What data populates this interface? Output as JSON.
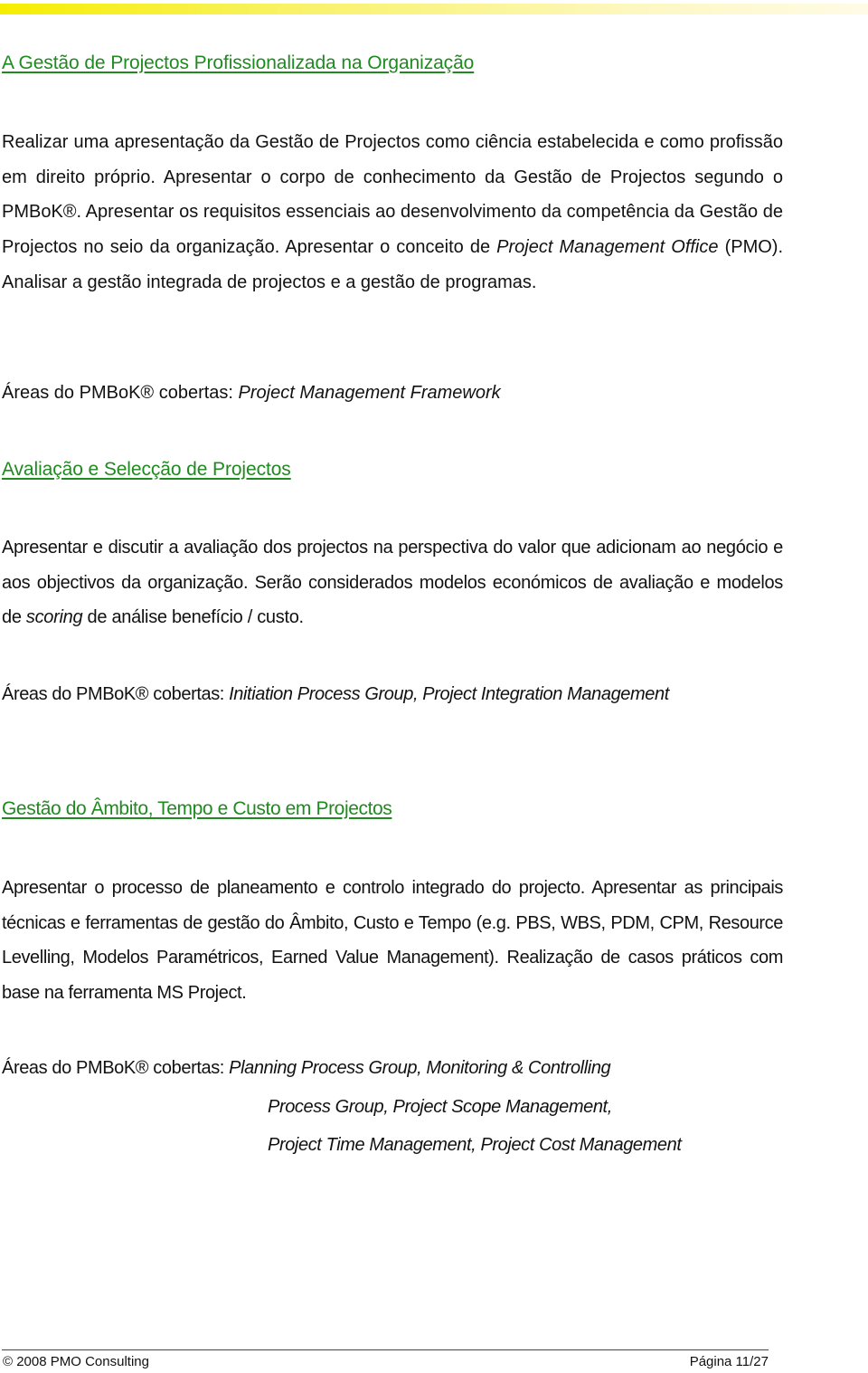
{
  "header": {
    "bar_color": "#f6ee00"
  },
  "sections": [
    {
      "title": "A Gestão de Projectos Profissionalizada na Organização",
      "body_parts": [
        "Realizar uma apresentação da Gestão de Projectos como ciência estabelecida e como profissão em direito próprio. Apresentar o corpo de conhecimento da Gestão de Projectos segundo o PMBoK®. Apresentar os requisitos essenciais ao desenvolvimento da competência da Gestão de Projectos no seio da organização. Apresentar o conceito de ",
        "Project Management Office",
        " (PMO). Analisar a gestão integrada de projectos e a gestão de programas."
      ],
      "areas_label": "Áreas do PMBoK® cobertas: ",
      "areas": "Project Management Framework"
    },
    {
      "title": "Avaliação e Selecção de Projectos",
      "body_parts": [
        "Apresentar e discutir a avaliação dos projectos na perspectiva do valor que adicionam ao negócio e aos objectivos da organização. Serão considerados modelos económicos de avaliação e modelos de ",
        "scoring",
        " de análise benefício / custo."
      ],
      "areas_label": "Áreas do PMBoK® cobertas: ",
      "areas": "Initiation Process Group, Project Integration Management"
    },
    {
      "title": "Gestão do Âmbito, Tempo e Custo em Projectos",
      "body": "Apresentar o processo de planeamento e controlo integrado do projecto. Apresentar as principais técnicas e ferramentas de gestão do Âmbito, Custo e Tempo (e.g. PBS, WBS, PDM, CPM, Resource Levelling, Modelos Paramétricos, Earned Value Management). Realização de casos práticos com base na ferramenta MS Project.",
      "areas_label": "Áreas do PMBoK® cobertas: ",
      "areas_lines": [
        "Planning Process Group, Monitoring & Controlling",
        "Process Group, Project Scope Management,",
        "Project Time Management, Project Cost Management"
      ]
    }
  ],
  "footer": {
    "copyright": "© 2008 PMO Consulting",
    "page": "Página 11/27"
  }
}
